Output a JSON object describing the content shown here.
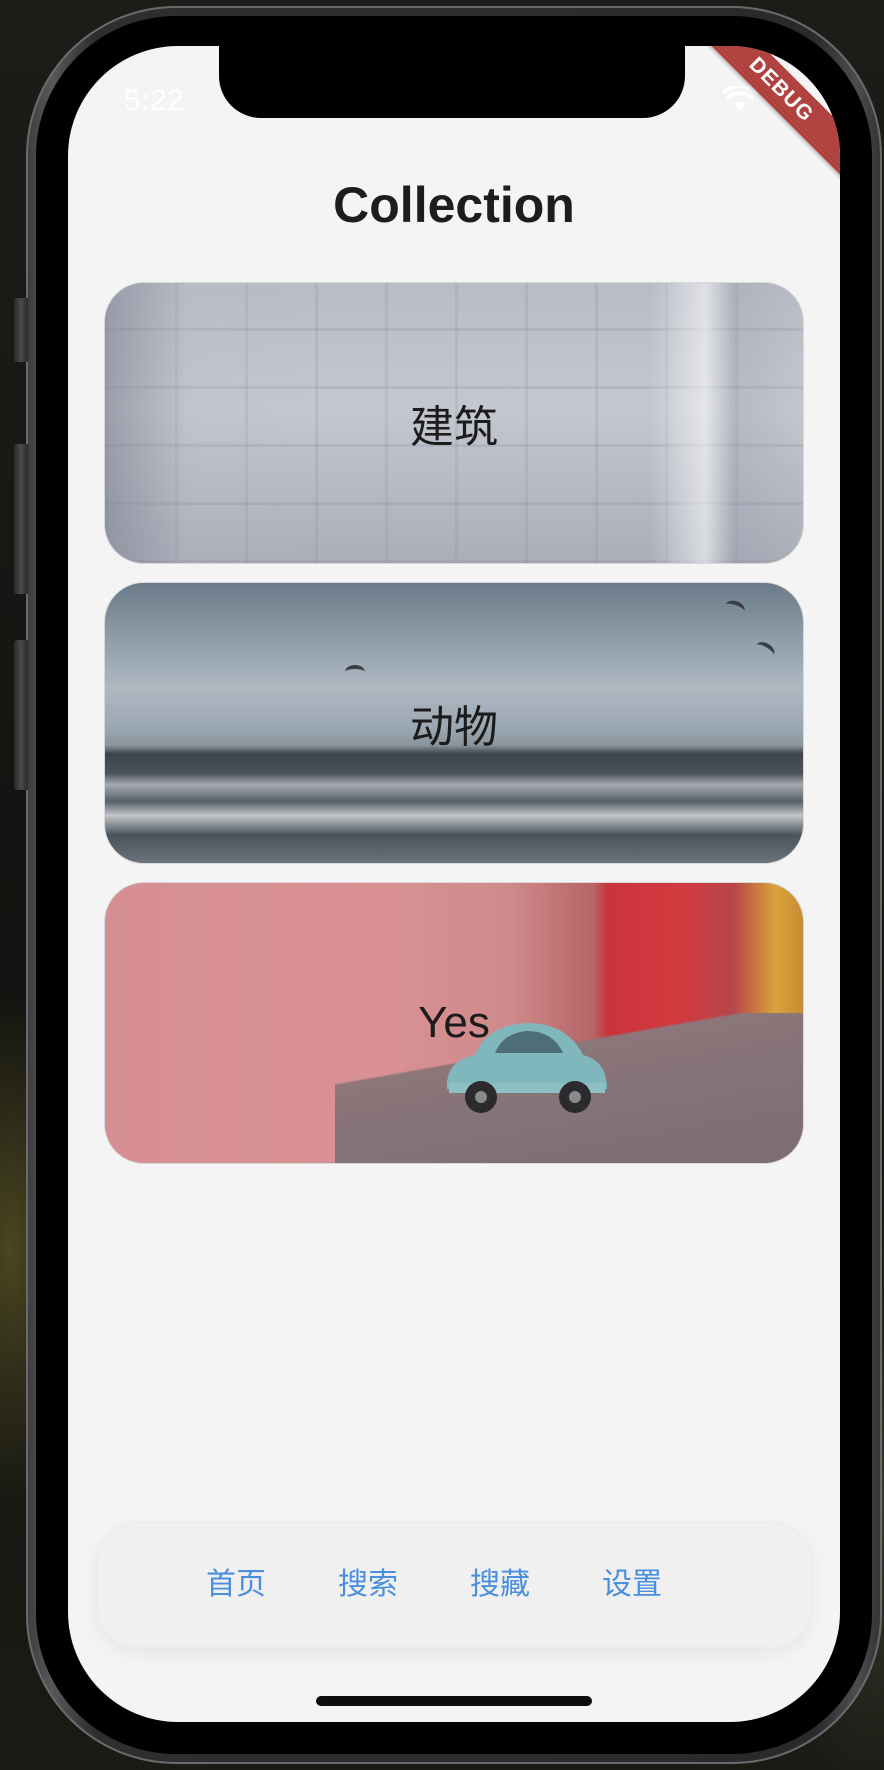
{
  "status_bar": {
    "time": "5:22",
    "wifi_icon": "wifi-icon",
    "battery_icon": "battery-icon",
    "debug_banner": "DEBUG"
  },
  "page": {
    "title": "Collection"
  },
  "cards": [
    {
      "label": "建筑",
      "image": "architecture-photo"
    },
    {
      "label": "动物",
      "image": "seagulls-over-ocean-photo"
    },
    {
      "label": "Yes",
      "image": "car-on-pink-street-photo"
    }
  ],
  "tab_bar": {
    "items": [
      {
        "label": "首页"
      },
      {
        "label": "搜索"
      },
      {
        "label": "搜藏"
      },
      {
        "label": "设置"
      }
    ],
    "accent_color": "#4a8fdc"
  },
  "colors": {
    "background": "#f4f4f4",
    "title_text": "#1d1d1d",
    "debug_ribbon": "#b0423f"
  }
}
